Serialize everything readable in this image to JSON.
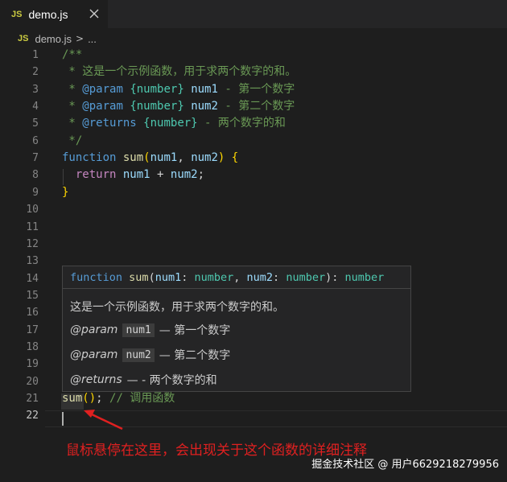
{
  "tab": {
    "badge": "JS",
    "title": "demo.js",
    "close_icon": "close-icon"
  },
  "breadcrumb": {
    "badge": "JS",
    "file": "demo.js",
    "separator": ">",
    "more": "..."
  },
  "line_numbers": [
    "1",
    "2",
    "3",
    "4",
    "5",
    "6",
    "7",
    "8",
    "9",
    "10",
    "11",
    "12",
    "13",
    "14",
    "15",
    "16",
    "17",
    "18",
    "19",
    "20",
    "21",
    "22"
  ],
  "active_line": "22",
  "code": {
    "l1": [
      {
        "t": "/**",
        "c": "cm"
      }
    ],
    "l2": [
      {
        "t": " * 这是一个示例函数，用于求两个数字的和。",
        "c": "cm"
      }
    ],
    "l3": [
      {
        "t": " * ",
        "c": "cm"
      },
      {
        "t": "@param",
        "c": "kw"
      },
      {
        "t": " ",
        "c": "cm"
      },
      {
        "t": "{number}",
        "c": "tp"
      },
      {
        "t": " ",
        "c": "cm"
      },
      {
        "t": "num1",
        "c": "pm"
      },
      {
        "t": " - 第一个数字",
        "c": "cm"
      }
    ],
    "l4": [
      {
        "t": " * ",
        "c": "cm"
      },
      {
        "t": "@param",
        "c": "kw"
      },
      {
        "t": " ",
        "c": "cm"
      },
      {
        "t": "{number}",
        "c": "tp"
      },
      {
        "t": " ",
        "c": "cm"
      },
      {
        "t": "num2",
        "c": "pm"
      },
      {
        "t": " - 第二个数字",
        "c": "cm"
      }
    ],
    "l5": [
      {
        "t": " * ",
        "c": "cm"
      },
      {
        "t": "@returns",
        "c": "kw"
      },
      {
        "t": " ",
        "c": "cm"
      },
      {
        "t": "{number}",
        "c": "tp"
      },
      {
        "t": " - 两个数字的和",
        "c": "cm"
      }
    ],
    "l6": [
      {
        "t": " */",
        "c": "cm"
      }
    ],
    "l7": [
      {
        "t": "function",
        "c": "kw"
      },
      {
        "t": " ",
        "c": "pu"
      },
      {
        "t": "sum",
        "c": "fn"
      },
      {
        "t": "(",
        "c": "br"
      },
      {
        "t": "num1",
        "c": "pm"
      },
      {
        "t": ", ",
        "c": "pu"
      },
      {
        "t": "num2",
        "c": "pm"
      },
      {
        "t": ")",
        "c": "br"
      },
      {
        "t": " ",
        "c": "pu"
      },
      {
        "t": "{",
        "c": "br"
      }
    ],
    "l8": [
      {
        "t": "  ",
        "c": "pu"
      },
      {
        "t": "return",
        "c": "ctl"
      },
      {
        "t": " ",
        "c": "pu"
      },
      {
        "t": "num1",
        "c": "pm"
      },
      {
        "t": " + ",
        "c": "pu"
      },
      {
        "t": "num2",
        "c": "pm"
      },
      {
        "t": ";",
        "c": "pu"
      }
    ],
    "l9": [
      {
        "t": "}",
        "c": "br"
      }
    ],
    "l21": [
      {
        "t": "sum",
        "c": "fn"
      },
      {
        "t": "()",
        "c": "br"
      },
      {
        "t": "; ",
        "c": "pu"
      },
      {
        "t": "// 调用函数",
        "c": "cm"
      }
    ]
  },
  "hover": {
    "signature": [
      {
        "t": "function",
        "c": "kw"
      },
      {
        "t": " ",
        "c": "pu"
      },
      {
        "t": "sum",
        "c": "fn"
      },
      {
        "t": "(",
        "c": "pu"
      },
      {
        "t": "num1",
        "c": "pm"
      },
      {
        "t": ": ",
        "c": "pu"
      },
      {
        "t": "number",
        "c": "tp"
      },
      {
        "t": ", ",
        "c": "pu"
      },
      {
        "t": "num2",
        "c": "pm"
      },
      {
        "t": ": ",
        "c": "pu"
      },
      {
        "t": "number",
        "c": "tp"
      },
      {
        "t": "): ",
        "c": "pu"
      },
      {
        "t": "number",
        "c": "tp"
      }
    ],
    "description": "这是一个示例函数，用于求两个数字的和。",
    "param1": {
      "tag": "@param",
      "name": "num1",
      "text": "— 第一个数字"
    },
    "param2": {
      "tag": "@param",
      "name": "num2",
      "text": "— 第二个数字"
    },
    "returns": {
      "tag": "@returns",
      "text": "— - 两个数字的和"
    }
  },
  "annotation": "鼠标悬停在这里，会出现关于这个函数的详细注释",
  "watermark": "掘金技术社区 @ 用户6629218279956",
  "colors": {
    "annotation": "#e02020",
    "js_badge": "#cbcb41",
    "background": "#1e1e1e"
  }
}
